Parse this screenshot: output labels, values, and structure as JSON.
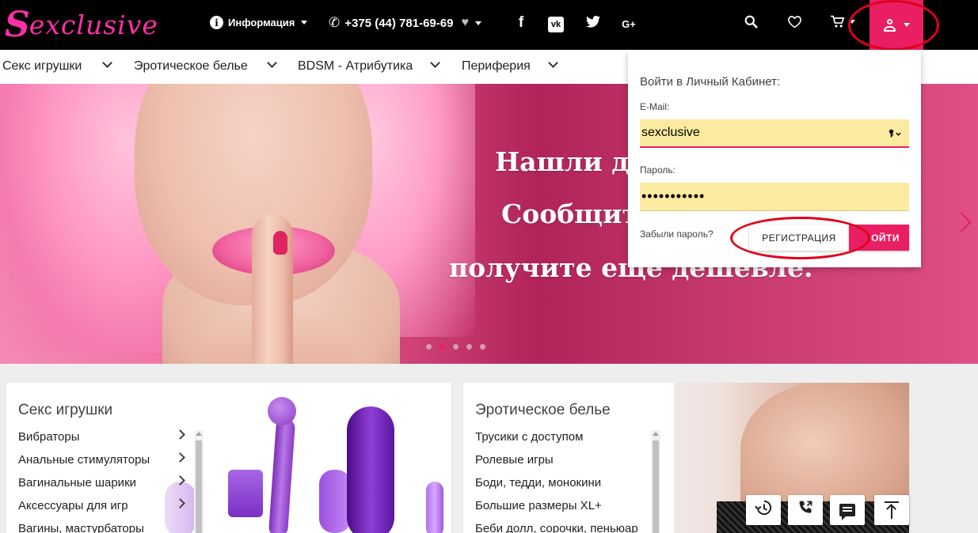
{
  "brand": {
    "logo_text": "Sexclusive",
    "logo_big": "S",
    "logo_rest": "exclusive",
    "accent_color": "#e91e63"
  },
  "topbar": {
    "info_icon": "i",
    "info_label": "Информация",
    "phone_icon": "✆",
    "phone": "+375 (44) 781-69-69",
    "heart_icon": "♥",
    "social": {
      "facebook": "f",
      "vk": "vk",
      "twitter": "🐦",
      "google_plus": "G+"
    },
    "search_icon": "search-icon",
    "wishlist_icon": "heart-icon",
    "cart_icon": "cart-icon",
    "account_icon": "user-icon"
  },
  "category_nav": [
    "Секс игрушки",
    "Эротическое белье",
    "BDSM - Атрибутика",
    "Периферия"
  ],
  "hero": {
    "lines": [
      "Нашли де",
      "Сообщит",
      "получите еще дешевле."
    ],
    "slides_total": 5,
    "active_slide": 2
  },
  "login": {
    "title": "Войти в Личный Кабинет:",
    "email_label": "E-Mail:",
    "email_value": "sexclusive",
    "password_label": "Пароль:",
    "password_value": "•••••••••••",
    "forgot": "Забыли пароль?",
    "register_button": "РЕГИСТРАЦИЯ",
    "login_button": "ВОЙТИ",
    "login_button_visible": "ОЙТИ"
  },
  "cards": [
    {
      "title": "Секс игрушки",
      "items": [
        "Вибраторы",
        "Анальные стимуляторы",
        "Вагинальные шарики",
        "Аксессуары для игр",
        "Вагины, мастурбаторы"
      ]
    },
    {
      "title": "Эротическое белье",
      "items": [
        "Трусики с доступом",
        "Ролевые игры",
        "Боди, тедди, монокини",
        "Большие размеры XL+",
        "Беби долл, сорочки, пеньюар"
      ]
    }
  ],
  "floating_buttons": [
    "history-icon",
    "callback-icon",
    "chat-icon",
    "scroll-top-icon"
  ]
}
